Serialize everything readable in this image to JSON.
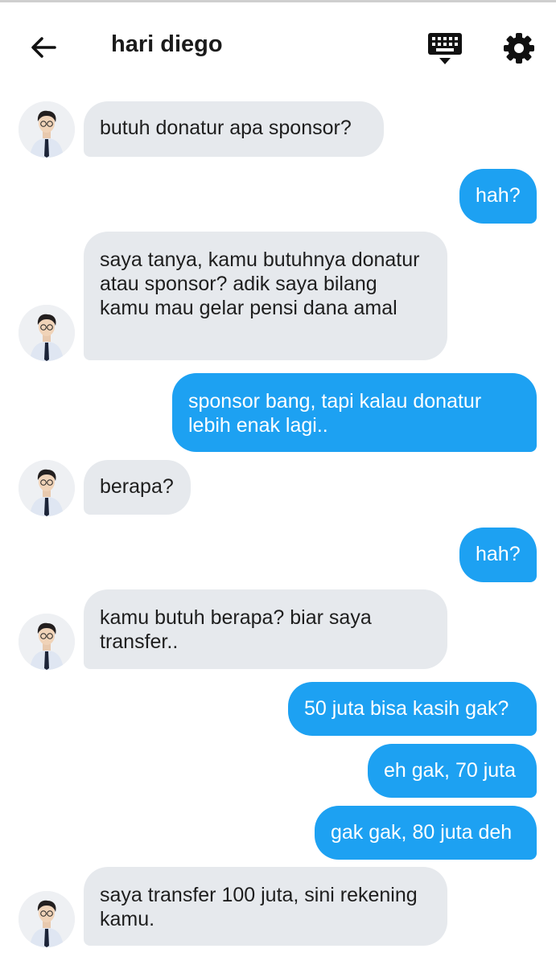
{
  "header": {
    "title": "hari diego",
    "icons": {
      "back": "arrow-left-icon",
      "keyboard": "keyboard-icon",
      "settings": "gear-icon"
    }
  },
  "colors": {
    "incoming_bubble": "#e6e9ed",
    "outgoing_bubble": "#1da1f2",
    "background": "#ffffff"
  },
  "messages": [
    {
      "from": "hari diego",
      "text": "butuh donatur apa sponsor?"
    },
    {
      "from": "me",
      "text": "hah?"
    },
    {
      "from": "hari diego",
      "text": "saya tanya, kamu butuhnya donatur atau sponsor? adik saya bilang kamu mau gelar pensi dana amal"
    },
    {
      "from": "me",
      "text": "sponsor bang, tapi kalau donatur lebih enak lagi.."
    },
    {
      "from": "hari diego",
      "text": "berapa?"
    },
    {
      "from": "me",
      "text": "hah?"
    },
    {
      "from": "hari diego",
      "text": "kamu butuh berapa? biar saya transfer.."
    },
    {
      "from": "me",
      "text": "50 juta bisa kasih gak?"
    },
    {
      "from": "me",
      "text": "eh gak, 70 juta"
    },
    {
      "from": "me",
      "text": "gak gak, 80 juta deh"
    },
    {
      "from": "hari diego",
      "text": "saya transfer 100 juta, sini rekening kamu."
    }
  ]
}
